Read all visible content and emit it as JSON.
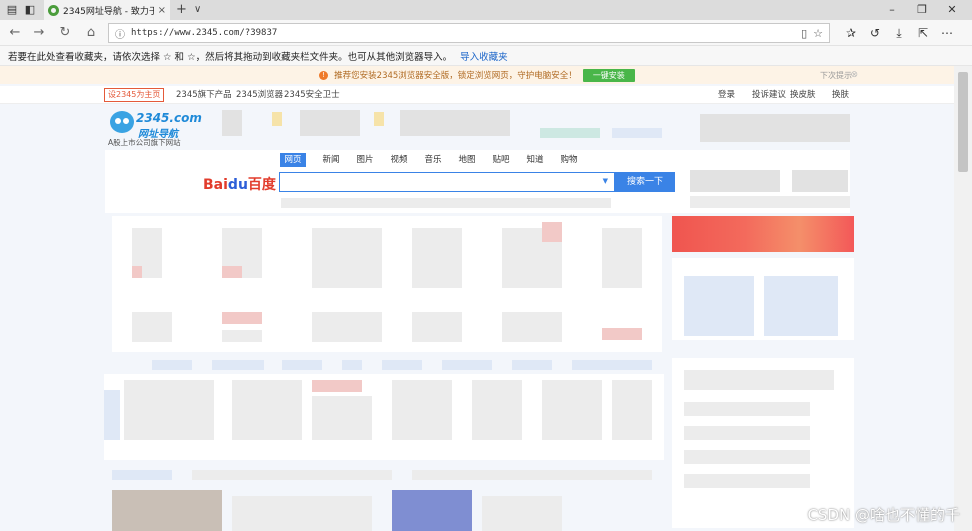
{
  "browser": {
    "tab_title": "2345网址导航 - 致力于",
    "tab_close": "×",
    "tab_new": "+",
    "tab_list": "∨",
    "address": "https://www.2345.com/?39837",
    "nav": {
      "back": "←",
      "forward": "→",
      "refresh": "↻",
      "home": "⌂"
    }
  },
  "favorites_bar": {
    "message": "若要在此处查看收藏夹，请依次选择 ☆ 和 ☆，然后将其拖动到收藏夹栏文件夹。也可从其他浏览器导入。",
    "import_link": "导入收藏夹"
  },
  "page": {
    "notice": {
      "text": "推荐您安装2345浏览器安全版，锁定浏览网页，守护电脑安全！",
      "button": "一键安装",
      "dismiss": "下次提示"
    },
    "topnav": {
      "home": "设2345为主页",
      "items": [
        "2345旗下产品",
        "2345浏览器",
        "2345安全卫士"
      ],
      "right": [
        "登录",
        "投诉建议",
        "换皮肤",
        "换肤"
      ]
    },
    "logo": {
      "brand": "2345.com",
      "name": "网址导航",
      "sub": "A股上市公司旗下网站"
    },
    "search": {
      "tabs": [
        "网页",
        "新闻",
        "图片",
        "视频",
        "音乐",
        "地图",
        "贴吧",
        "知道",
        "购物"
      ],
      "engine_parts": [
        "Bai",
        "du",
        "百度"
      ],
      "button": "搜索一下"
    }
  },
  "watermark": "CSDN @啥也不懂的千"
}
